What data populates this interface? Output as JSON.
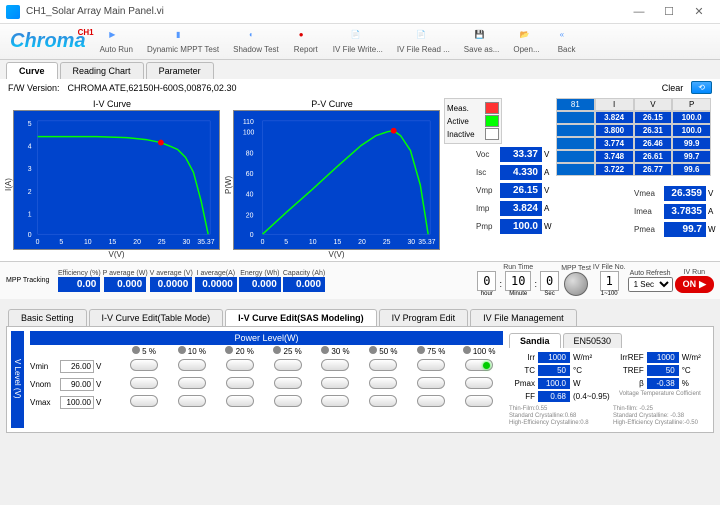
{
  "window": {
    "title": "CH1_Solar Array Main Panel.vi"
  },
  "logo": {
    "text": "Chroma",
    "badge": "CH1"
  },
  "toolbar": [
    {
      "label": "Auto Run",
      "icon": "play"
    },
    {
      "label": "Dynamic MPPT Test",
      "icon": "bars"
    },
    {
      "label": "Shadow Test",
      "icon": "shade"
    },
    {
      "label": "Report",
      "icon": "dot"
    },
    {
      "label": "IV File Write...",
      "icon": "file"
    },
    {
      "label": "IV File Read ...",
      "icon": "file"
    },
    {
      "label": "Save as...",
      "icon": "disk"
    },
    {
      "label": "Open...",
      "icon": "folder"
    },
    {
      "label": "Back",
      "icon": "back"
    }
  ],
  "tabs": {
    "main": [
      "Curve",
      "Reading Chart",
      "Parameter"
    ],
    "active": "Curve"
  },
  "fw": {
    "label": "F/W Version:",
    "value": "CHROMA ATE,62150H-600S,00876,02.30",
    "clear": "Clear"
  },
  "charts": {
    "iv": {
      "title": "I-V Curve",
      "xlabel": "V(V)",
      "ylabel": "I(A)"
    },
    "pv": {
      "title": "P-V Curve",
      "xlabel": "V(V)",
      "ylabel": "P(W)"
    }
  },
  "chart_data": [
    {
      "type": "line",
      "title": "I-V Curve",
      "xlabel": "V(V)",
      "ylabel": "I(A)",
      "xlim": [
        0,
        35.37
      ],
      "ylim": [
        0,
        5
      ],
      "xticks": [
        0,
        5,
        10,
        15,
        20,
        25,
        30,
        35.37
      ],
      "yticks": [
        0,
        1,
        2,
        3,
        4,
        5
      ],
      "series": [
        {
          "name": "Active",
          "color": "#00ff00",
          "x": [
            0,
            5,
            10,
            15,
            20,
            23,
            25,
            26.15,
            28,
            30,
            32,
            33.37
          ],
          "y": [
            4.33,
            4.33,
            4.33,
            4.32,
            4.28,
            4.15,
            3.98,
            3.824,
            3.4,
            2.7,
            1.5,
            0
          ]
        }
      ],
      "marker": {
        "x": 23,
        "y": 4.15,
        "color": "#ff0000"
      }
    },
    {
      "type": "line",
      "title": "P-V Curve",
      "xlabel": "V(V)",
      "ylabel": "P(W)",
      "xlim": [
        0,
        35.37
      ],
      "ylim": [
        0,
        110
      ],
      "xticks": [
        0,
        5,
        10,
        15,
        20,
        25,
        30,
        35.37
      ],
      "yticks": [
        0,
        20,
        40,
        60,
        80,
        100,
        110
      ],
      "series": [
        {
          "name": "Active",
          "color": "#00ff00",
          "x": [
            0,
            5,
            10,
            15,
            20,
            23,
            25,
            26.15,
            28,
            30,
            32,
            33.37
          ],
          "y": [
            0,
            21.6,
            43.3,
            64.8,
            85.6,
            95.5,
            99.5,
            100.0,
            95.2,
            81,
            48,
            0
          ]
        }
      ],
      "marker": {
        "x": 26.15,
        "y": 100,
        "color": "#ff0000"
      }
    }
  ],
  "meas": {
    "title": "Meas.",
    "active": "Active",
    "inactive": "Inactive"
  },
  "readings": {
    "Voc": {
      "v": "33.37",
      "u": "V"
    },
    "Isc": {
      "v": "4.330",
      "u": "A"
    },
    "Vmp": {
      "v": "26.15",
      "u": "V"
    },
    "Imp": {
      "v": "3.824",
      "u": "A"
    },
    "Pmp": {
      "v": "100.0",
      "u": "W"
    }
  },
  "table": {
    "headers": [
      "I",
      "V",
      "P"
    ],
    "index_first": "81",
    "rows": [
      [
        "3.824",
        "26.15",
        "100.0"
      ],
      [
        "3.800",
        "26.31",
        "100.0"
      ],
      [
        "3.774",
        "26.46",
        "99.9"
      ],
      [
        "3.748",
        "26.61",
        "99.7"
      ],
      [
        "3.722",
        "26.77",
        "99.6"
      ]
    ]
  },
  "side_vals": {
    "Vmea": {
      "v": "26.359",
      "u": "V"
    },
    "Imea": {
      "v": "3.7835",
      "u": "A"
    },
    "Pmea": {
      "v": "99.7",
      "u": "W"
    }
  },
  "mpp": {
    "title": "MPP Tracking",
    "cells": [
      {
        "l": "Efficiency (%)",
        "v": "0.00"
      },
      {
        "l": "P average (W)",
        "v": "0.000"
      },
      {
        "l": "V average (V)",
        "v": "0.0000"
      },
      {
        "l": "I average(A)",
        "v": "0.0000"
      },
      {
        "l": "Energy (Wh)",
        "v": "0.000"
      },
      {
        "l": "Capacity (Ah)",
        "v": "0.000"
      }
    ],
    "runtime": {
      "label": "Run Time",
      "h": "0",
      "m": "10",
      "s": "0",
      "hl": "hour",
      "ml": "Minute",
      "sl": "Sec"
    },
    "mpptest": "MPP Test",
    "fileno": {
      "l": "IV File No.",
      "v": "1",
      "hint": "1~100"
    },
    "autorefresh": {
      "l": "Auto Refresh",
      "v": "1 Sec"
    },
    "ivrun": {
      "l": "IV Run",
      "btn": "ON"
    }
  },
  "lower_tabs": [
    "Basic Setting",
    "I-V Curve Edit(Table Mode)",
    "I-V Curve Edit(SAS Modeling)",
    "IV Program Edit",
    "IV File Management"
  ],
  "lower_active": "I-V Curve Edit(SAS Modeling)",
  "sandia_tabs": [
    "Sandia",
    "EN50530"
  ],
  "sandia_active": "Sandia",
  "power": {
    "title": "Power Level(W)",
    "cols": [
      "5",
      "10",
      "20",
      "25",
      "30",
      "50",
      "75",
      "100"
    ],
    "unit": "%"
  },
  "vlevel": {
    "title": "V Level (V)",
    "rows": [
      {
        "l": "Vmin",
        "v": "26.00",
        "u": "V"
      },
      {
        "l": "Vnom",
        "v": "90.00",
        "u": "V"
      },
      {
        "l": "Vmax",
        "v": "100.00",
        "u": "V"
      }
    ]
  },
  "params": {
    "left": [
      {
        "l": "Irr",
        "v": "1000",
        "u": "W/m²"
      },
      {
        "l": "TC",
        "v": "50",
        "u": "°C"
      },
      {
        "l": "Pmax",
        "v": "100.0",
        "u": "W"
      },
      {
        "l": "FF",
        "v": "0.68",
        "u": "(0.4~0.95)"
      }
    ],
    "right": [
      {
        "l": "IrrREF",
        "v": "1000",
        "u": "W/m²"
      },
      {
        "l": "TREF",
        "v": "50",
        "u": "°C"
      },
      {
        "l": "β",
        "v": "-0.38",
        "u": "%"
      }
    ],
    "note_right_title": "Voltage Temperature Cofficient",
    "notes_left": "Thin-Film:0.55\nStandard Crystalline:0.68\nHigh-Efficiency Crystalline:0.8",
    "notes_right": "Thin-film: -0.25\nStandard Crystalline: -0.38\nHigh-Efficiency Crystalline:-0.50"
  }
}
